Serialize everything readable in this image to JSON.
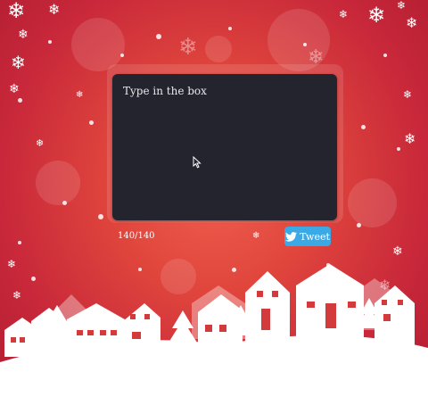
{
  "composer": {
    "text": "Type in the box",
    "char_count": "140/140"
  },
  "actions": {
    "tweet_label": "Tweet",
    "tweet_icon": "twitter-bird-icon"
  },
  "icons": {
    "cursor": "mouse-pointer-icon",
    "snowflake": "snowflake-icon"
  },
  "colors": {
    "background": "#d8363c",
    "panel": "#23242d",
    "tweet_button": "#3ba9e6",
    "snow": "#ffffff"
  }
}
